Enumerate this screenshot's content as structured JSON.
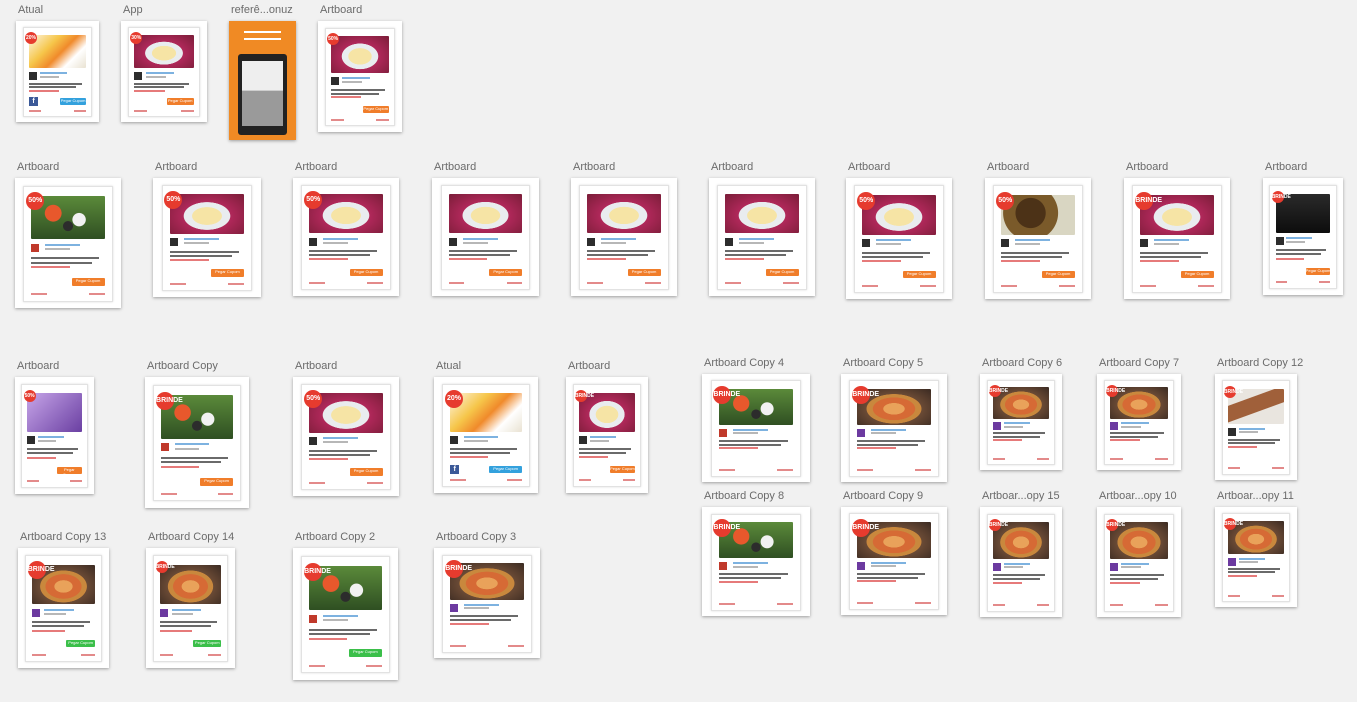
{
  "canvas": {
    "background": "#f1f1f1"
  },
  "colors": {
    "badge": "#e63b2e",
    "button": "#f07d2a",
    "accent_blue": "#33a1dd",
    "accent_green": "#3bbf4a"
  },
  "artboards": [
    {
      "label": "Atual",
      "badge": "20%",
      "photo": "breakfast",
      "button": "blue",
      "button_label": "Pegar Cupom"
    },
    {
      "label": "App",
      "badge": "30%",
      "photo": "salad",
      "button": "orange",
      "button_label": "Pegar Cupom"
    },
    {
      "label": "referê...onuz"
    },
    {
      "label": "Artboard",
      "badge": "50%",
      "photo": "salad",
      "button": "orange",
      "button_label": "Pegar Cupom"
    },
    {
      "label": "Artboard",
      "badge": "50%",
      "photo": "sushi",
      "button": "orange",
      "button_label": "Pegar Cupom"
    },
    {
      "label": "Artboard",
      "badge": "50%",
      "photo": "salad",
      "button": "orange",
      "button_label": "Pegar Cupom"
    },
    {
      "label": "Artboard",
      "badge": "50%",
      "photo": "salad",
      "button": "orange",
      "button_label": "Pegar Cupom"
    },
    {
      "label": "Artboard",
      "badge": "",
      "photo": "salad",
      "button": "orange",
      "button_label": "Pegar Cupom"
    },
    {
      "label": "Artboard",
      "badge": "",
      "photo": "salad",
      "button": "orange",
      "button_label": "Pegar Cupom"
    },
    {
      "label": "Artboard",
      "badge": "",
      "photo": "salad",
      "button": "orange",
      "button_label": "Pegar Cupom"
    },
    {
      "label": "Artboard",
      "badge": "50%",
      "photo": "salad",
      "button": "orange",
      "button_label": "Pegar Cupom"
    },
    {
      "label": "Artboard",
      "badge": "50%",
      "photo": "beef",
      "button": "orange",
      "button_label": "Pegar Cupom"
    },
    {
      "label": "Artboard",
      "badge": "BRINDE",
      "photo": "salad",
      "button": "orange",
      "button_label": "Pegar Cupom"
    },
    {
      "label": "Artboard",
      "badge": "BRINDE",
      "photo": "dark",
      "button": "orange",
      "button_label": "Pegar Cupom"
    },
    {
      "label": "Artboard",
      "badge": "50%",
      "photo": "purple",
      "button": "orange",
      "button_label": "Pegar Cupom"
    },
    {
      "label": "Artboard Copy",
      "badge": "BRINDE",
      "photo": "sushi",
      "button": "orange",
      "button_label": "Pegar Cupom"
    },
    {
      "label": "Artboard",
      "badge": "50%",
      "photo": "salad",
      "button": "orange",
      "button_label": "Pegar Cupom"
    },
    {
      "label": "Atual",
      "badge": "20%",
      "photo": "breakfast",
      "button": "blue",
      "button_label": "Pegar Cupom"
    },
    {
      "label": "Artboard",
      "badge": "BRINDE",
      "photo": "salad",
      "button": "orange",
      "button_label": "Pegar Cupom"
    },
    {
      "label": "Artboard Copy 4",
      "badge": "BRINDE",
      "photo": "sushi",
      "button": "none"
    },
    {
      "label": "Artboard Copy 5",
      "badge": "BRINDE",
      "photo": "pizza",
      "button": "none"
    },
    {
      "label": "Artboard Copy 6",
      "badge": "BRINDE",
      "photo": "pizza",
      "button": "none"
    },
    {
      "label": "Artboard Copy 7",
      "badge": "BRINDE",
      "photo": "pizza",
      "button": "none"
    },
    {
      "label": "Artboard Copy 12",
      "badge": "BRINDE",
      "photo": "sausage",
      "button": "none"
    },
    {
      "label": "Artboard Copy 8",
      "badge": "BRINDE",
      "photo": "sushi",
      "button": "none"
    },
    {
      "label": "Artboard Copy 9",
      "badge": "BRINDE",
      "photo": "pizza",
      "button": "none"
    },
    {
      "label": "Artboar...opy 15",
      "badge": "BRINDE",
      "photo": "pizza",
      "button": "none"
    },
    {
      "label": "Artboar...opy 10",
      "badge": "BRINDE",
      "photo": "pizza",
      "button": "none"
    },
    {
      "label": "Artboar...opy 11",
      "badge": "BRINDE",
      "photo": "pizza",
      "button": "none"
    },
    {
      "label": "Artboard Copy 13",
      "badge": "BRINDE",
      "photo": "pizza",
      "button": "green",
      "button_label": "Pegar Cupom"
    },
    {
      "label": "Artboard Copy 14",
      "badge": "BRINDE",
      "photo": "pizza",
      "button": "green",
      "button_label": "Pegar Cupom"
    },
    {
      "label": "Artboard Copy 2",
      "badge": "BRINDE",
      "photo": "sushi",
      "button": "green",
      "button_label": "Pegar Cupom"
    },
    {
      "label": "Artboard Copy 3",
      "badge": "BRINDE",
      "photo": "pizza",
      "button": "none"
    }
  ]
}
